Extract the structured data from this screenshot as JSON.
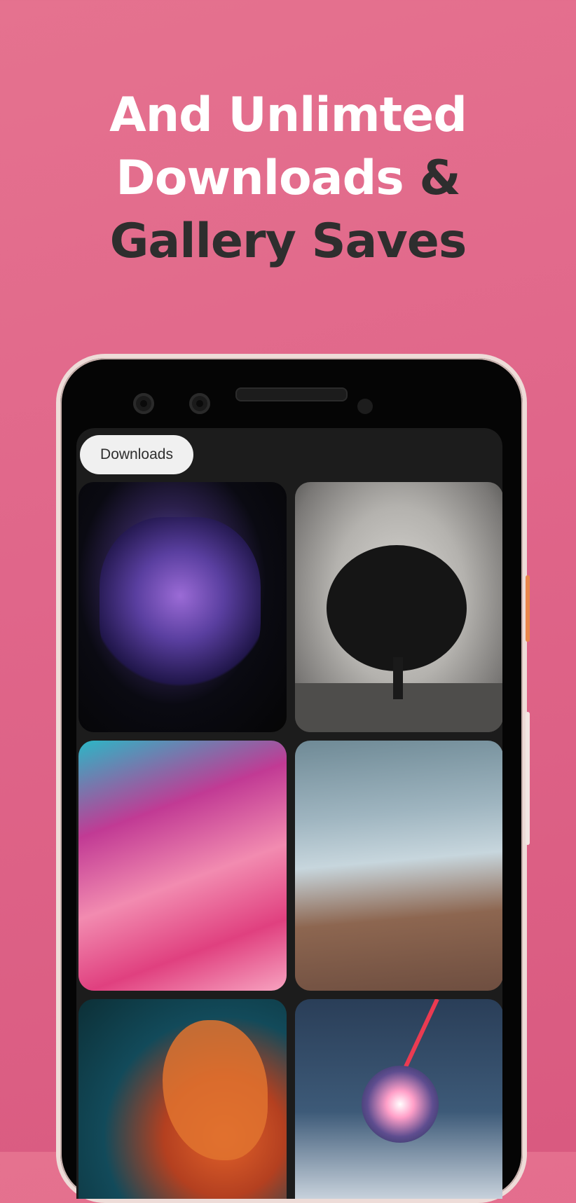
{
  "headline": {
    "line1": "And Unlimted",
    "line2_part1": "Downloads",
    "line2_part2": "&",
    "line3": "Gallery Saves"
  },
  "app": {
    "chip_label": "Downloads"
  },
  "gallery": {
    "tiles": [
      {
        "name": "abstract-purple-glitch"
      },
      {
        "name": "misty-tree"
      },
      {
        "name": "pink-teal-fluid"
      },
      {
        "name": "aerial-canyon"
      },
      {
        "name": "orange-teal-fluid"
      },
      {
        "name": "glowing-orb-sky"
      }
    ]
  },
  "colors": {
    "background": "#e0668a",
    "headline_white": "#ffffff",
    "headline_dark": "#2e2e2e",
    "chip_bg": "#f0f0f0",
    "screen_bg": "#1c1c1c"
  }
}
